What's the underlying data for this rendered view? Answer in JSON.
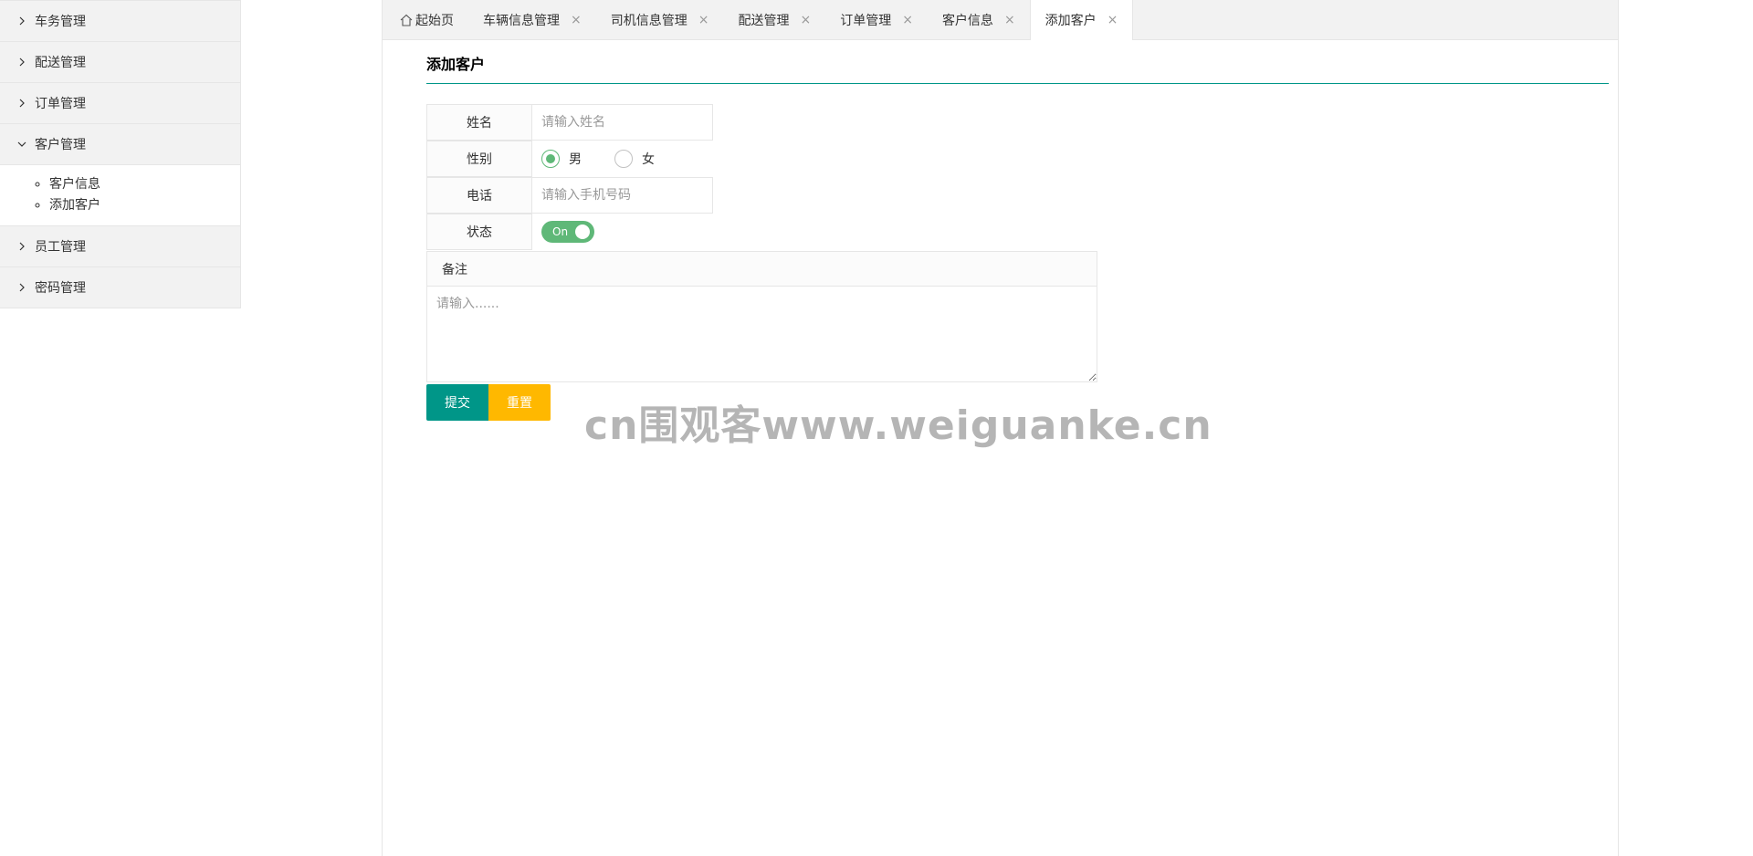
{
  "sidebar": {
    "items": [
      {
        "label": "车务管理",
        "expanded": false
      },
      {
        "label": "配送管理",
        "expanded": false
      },
      {
        "label": "订单管理",
        "expanded": false
      },
      {
        "label": "客户管理",
        "expanded": true,
        "children": [
          "客户信息",
          "添加客户"
        ]
      },
      {
        "label": "员工管理",
        "expanded": false
      },
      {
        "label": "密码管理",
        "expanded": false
      }
    ]
  },
  "tabs": [
    {
      "label": "起始页",
      "icon": "home-icon",
      "closable": false
    },
    {
      "label": "车辆信息管理",
      "closable": true
    },
    {
      "label": "司机信息管理",
      "closable": true
    },
    {
      "label": "配送管理",
      "closable": true
    },
    {
      "label": "订单管理",
      "closable": true
    },
    {
      "label": "客户信息",
      "closable": true
    },
    {
      "label": "添加客户",
      "closable": true,
      "active": true
    }
  ],
  "close_glyph": "×",
  "form": {
    "title": "添加客户",
    "name_label": "姓名",
    "name_placeholder": "请输入姓名",
    "gender_label": "性别",
    "gender_options": [
      "男",
      "女"
    ],
    "gender_selected": "男",
    "phone_label": "电话",
    "phone_placeholder": "请输入手机号码",
    "status_label": "状态",
    "status_switch_text": "On",
    "status_on": true,
    "remark_label": "备注",
    "remark_placeholder": "请输入......",
    "submit_label": "提交",
    "reset_label": "重置"
  },
  "watermark": "cn围观客www.weiguanke.cn",
  "colors": {
    "primary": "#009688",
    "warm": "#FFB800",
    "switch_on": "#5FB878",
    "sidebar_bg": "#f2f2f2"
  }
}
